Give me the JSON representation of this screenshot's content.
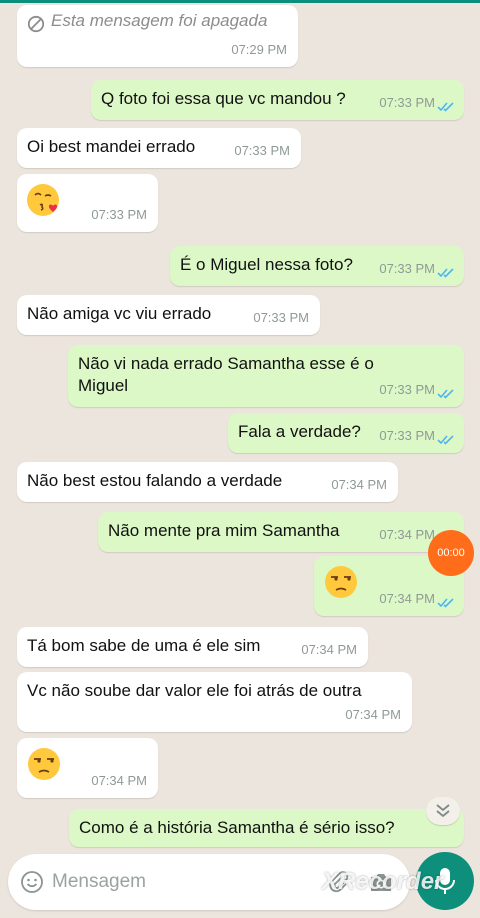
{
  "colors": {
    "incoming": "#ffffff",
    "outgoing": "#dcf8c6",
    "read_ticks": "#4fb6ec",
    "accent": "#0d8f7b"
  },
  "messages": [
    {
      "dir": "in",
      "text": "Esta mensagem foi apagada",
      "time": "07:29 PM",
      "icon": "ban-icon"
    },
    {
      "dir": "out",
      "text": "Q foto foi essa que vc mandou ?",
      "time": "07:33 PM"
    },
    {
      "dir": "in",
      "text": "Oi best mandei errado",
      "time": "07:33 PM"
    },
    {
      "dir": "in",
      "emoji": "kissing-face-with-heart-emoji",
      "time": "07:33 PM"
    },
    {
      "dir": "out",
      "text": "É o Miguel nessa foto?",
      "time": "07:33 PM"
    },
    {
      "dir": "in",
      "text": "Não amiga vc viu errado",
      "time": "07:33 PM"
    },
    {
      "dir": "out",
      "text": "Não vi nada errado Samantha esse é o Miguel",
      "time": "07:33 PM"
    },
    {
      "dir": "out",
      "text": "Fala a verdade?",
      "time": "07:33 PM"
    },
    {
      "dir": "in",
      "text": "Não best estou falando a verdade",
      "time": "07:34 PM"
    },
    {
      "dir": "out",
      "text": "Não mente pra mim Samantha",
      "time": "07:34 PM"
    },
    {
      "dir": "out",
      "emoji": "unamused-face-emoji",
      "time": "07:34 PM"
    },
    {
      "dir": "in",
      "text": "Tá bom sabe de uma é ele sim",
      "time": "07:34 PM"
    },
    {
      "dir": "in",
      "text": "Vc não soube dar valor ele foi atrás de outra",
      "time": "07:34 PM"
    },
    {
      "dir": "in",
      "emoji": "unamused-face-emoji",
      "time": "07:34 PM"
    },
    {
      "dir": "out",
      "text": "Como é a história Samantha é sério isso?"
    }
  ],
  "recorder": {
    "timer": "00:00",
    "watermark": "XRecorder"
  },
  "composer": {
    "placeholder": "Mensagem"
  },
  "icons": [
    "ban-icon",
    "double-check-icon",
    "chevron-down-icon",
    "smiley-icon",
    "paperclip-icon",
    "camera-icon",
    "microphone-icon"
  ]
}
